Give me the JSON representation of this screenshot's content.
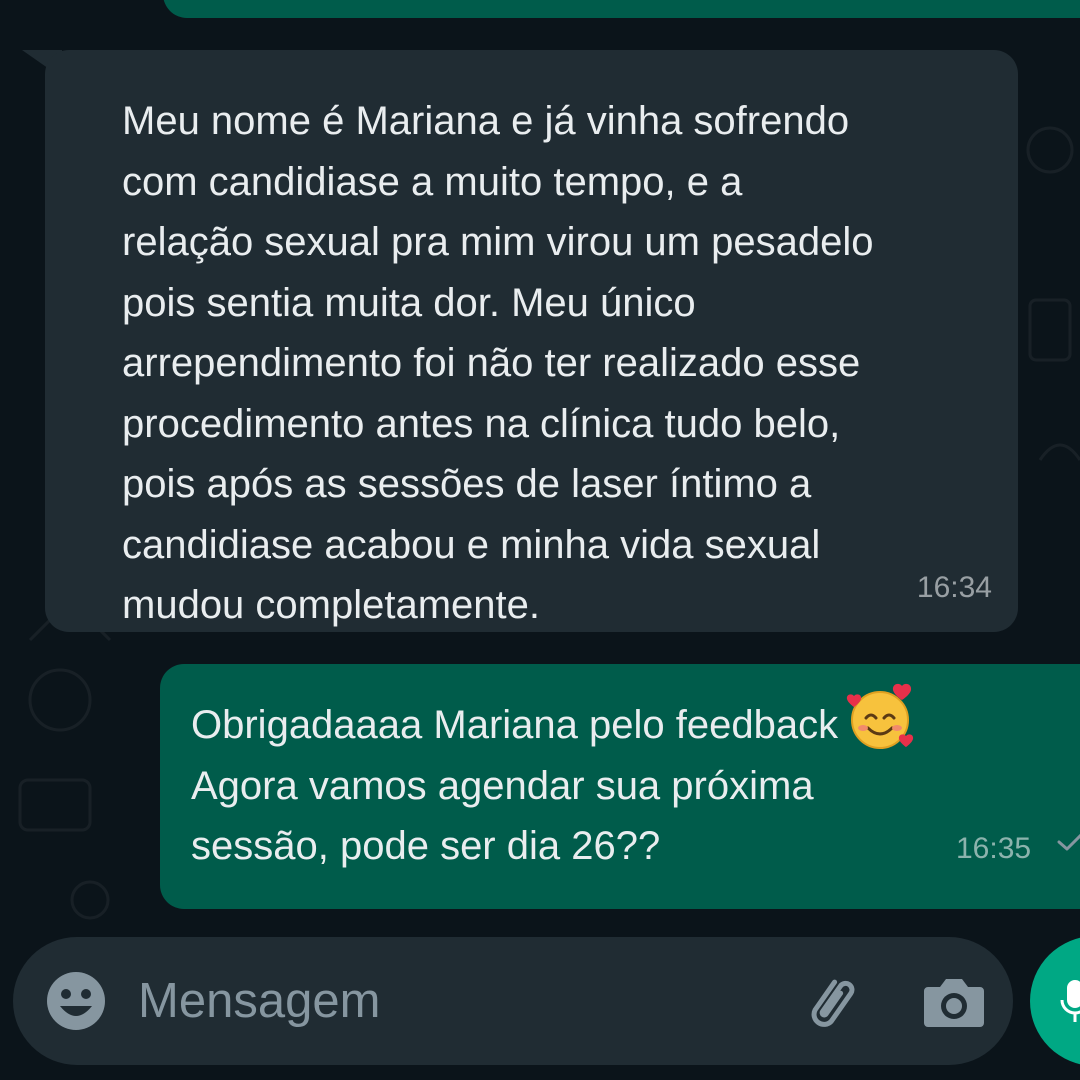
{
  "conversation": {
    "incoming_message": {
      "lines": [
        "Meu nome é Mariana e já vinha sofrendo",
        "com candidiase a muito tempo, e a",
        "relação sexual pra mim virou um pesadelo",
        "pois sentia muita dor. Meu único",
        "arrependimento foi não ter realizado esse",
        "procedimento antes na clínica tudo belo,",
        "pois após as sessões de laser íntimo a",
        "candidiase acabou e minha vida sexual",
        "mudou completamente."
      ],
      "time": "16:34"
    },
    "outgoing_message": {
      "lines": [
        "Obrigadaaaa Mariana pelo feedback",
        "Agora vamos agendar sua próxima",
        "sessão, pode ser dia 26??"
      ],
      "emoji": "smiling-face-with-hearts",
      "time": "16:35",
      "status": "sent"
    }
  },
  "composer": {
    "placeholder": "Mensagem",
    "value": "",
    "icons": [
      "emoji-icon",
      "paperclip-icon",
      "camera-icon",
      "mic-icon"
    ]
  },
  "colors": {
    "background": "#0b141a",
    "incoming_bubble": "#202c33",
    "outgoing_bubble": "#005c4b",
    "text": "#e9edef",
    "timestamp": "#8696a0",
    "accent": "#00a884"
  }
}
